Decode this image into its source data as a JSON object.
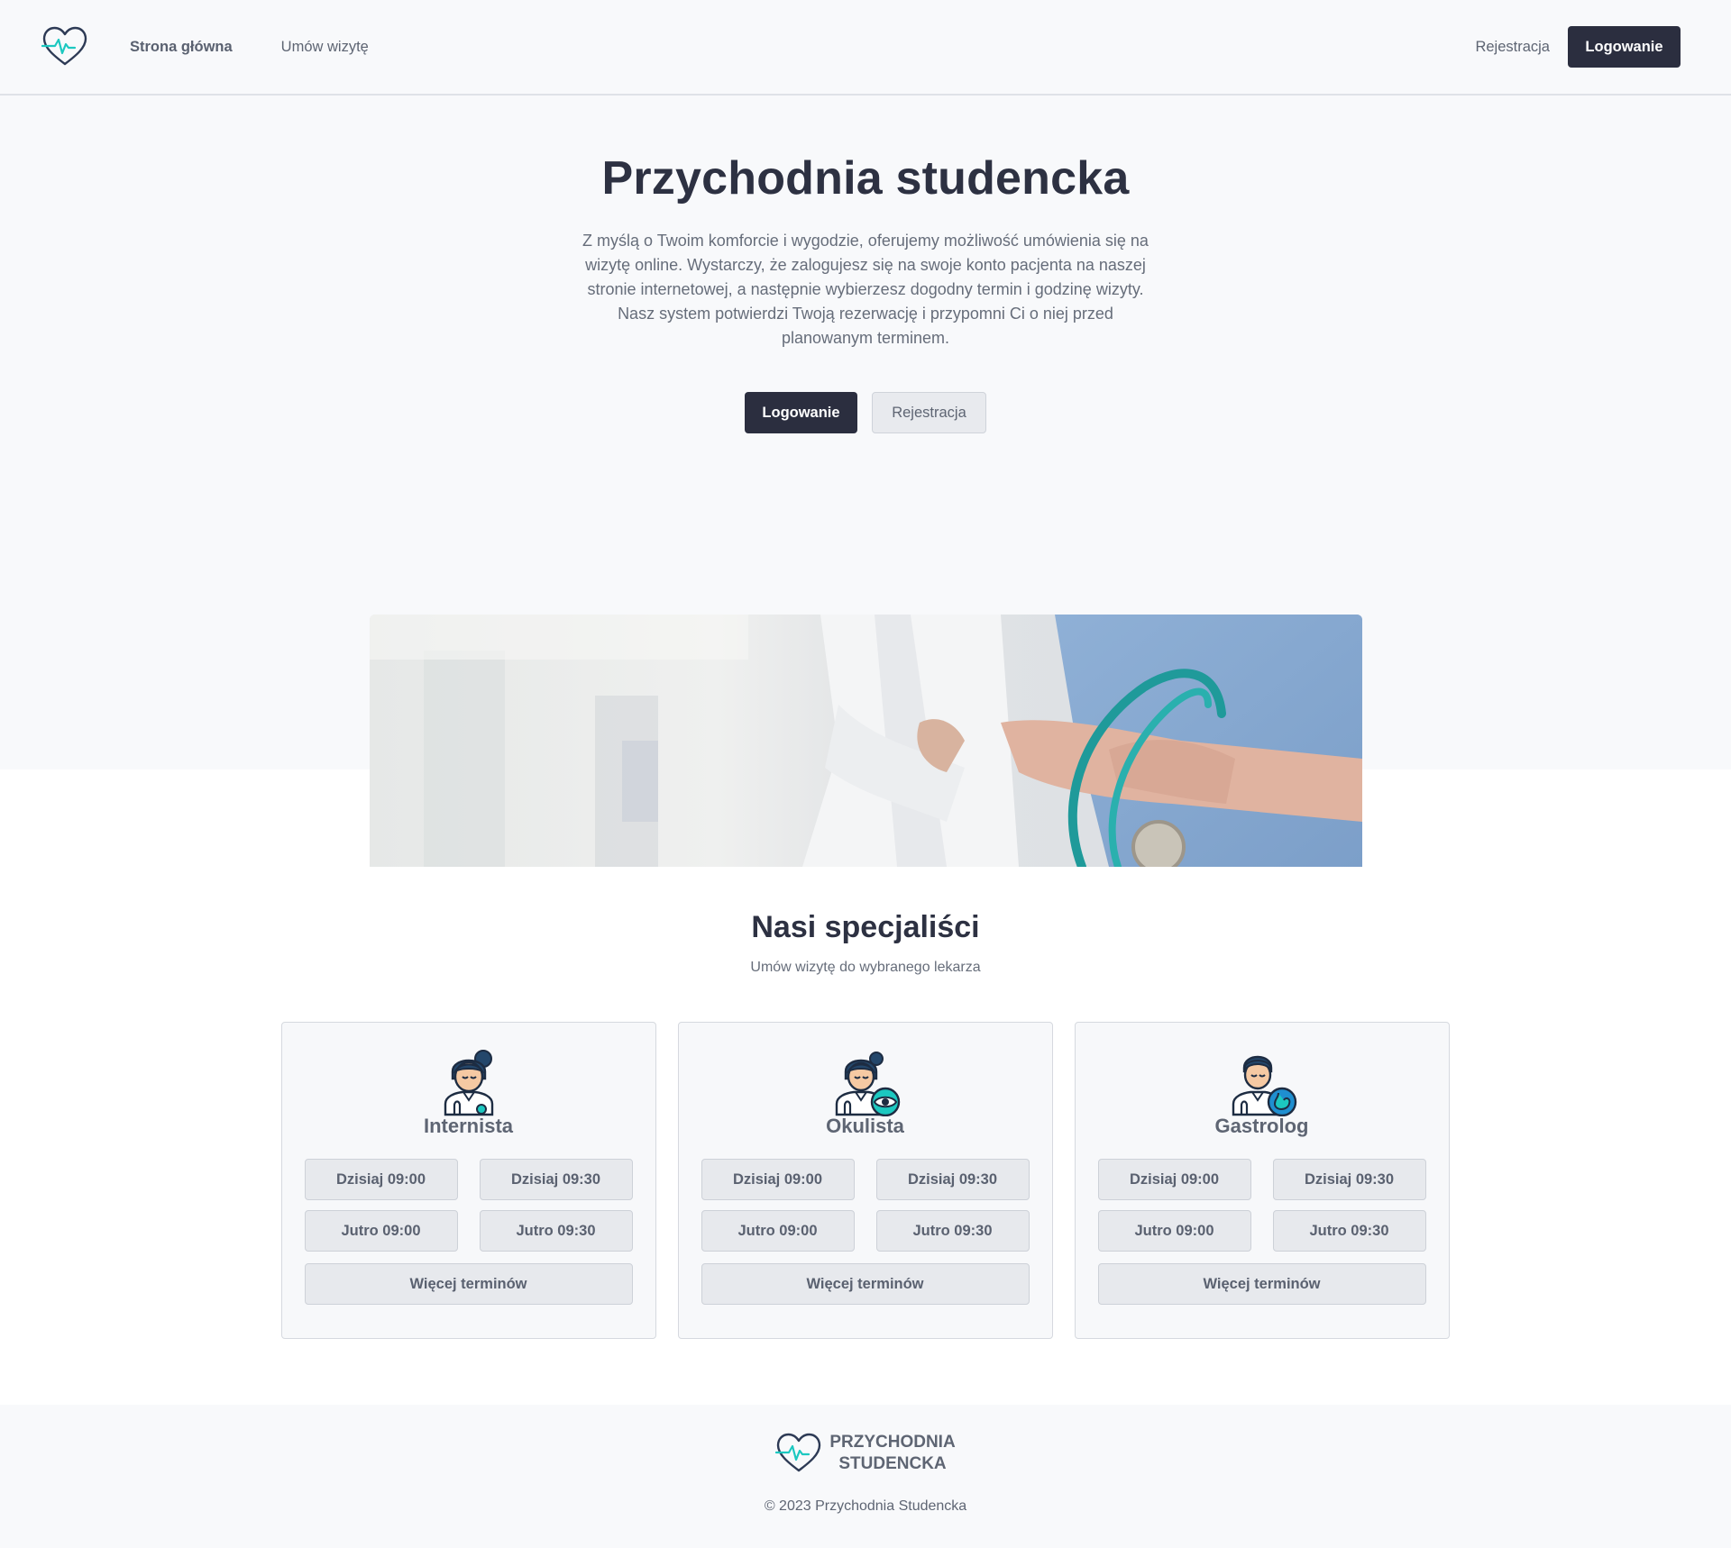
{
  "nav": {
    "home_label": "Strona główna",
    "book_label": "Umów wizytę",
    "register_label": "Rejestracja",
    "login_label": "Logowanie"
  },
  "hero": {
    "title": "Przychodnia studencka",
    "description": "Z myślą o Twoim komforcie i wygodzie, oferujemy możliwość umówienia się na wizytę online. Wystarczy, że zalogujesz się na swoje konto pacjenta na naszej stronie internetowej, a następnie wybierzesz dogodny termin i godzinę wizyty. Nasz system potwierdzi Twoją rezerwację i przypomni Ci o niej przed planowanym terminem.",
    "login_label": "Logowanie",
    "register_label": "Rejestracja"
  },
  "specialists": {
    "title": "Nasi specjaliści",
    "subtitle": "Umów wizytę do wybranego lekarza",
    "doctors": [
      {
        "name": "Internista",
        "icon": "female-doctor-icon",
        "slots": [
          "Dzisiaj 09:00",
          "Dzisiaj 09:30",
          "Jutro 09:00",
          "Jutro 09:30"
        ],
        "more_label": "Więcej terminów"
      },
      {
        "name": "Okulista",
        "icon": "eye-doctor-icon",
        "slots": [
          "Dzisiaj 09:00",
          "Dzisiaj 09:30",
          "Jutro 09:00",
          "Jutro 09:30"
        ],
        "more_label": "Więcej terminów"
      },
      {
        "name": "Gastrolog",
        "icon": "stomach-doctor-icon",
        "slots": [
          "Dzisiaj 09:00",
          "Dzisiaj 09:30",
          "Jutro 09:00",
          "Jutro 09:30"
        ],
        "more_label": "Więcej terminów"
      }
    ]
  },
  "footer": {
    "brand_line1": "PRZYCHODNIA",
    "brand_line2": "STUDENCKA",
    "copyright": "© 2023 Przychodnia Studencka"
  },
  "colors": {
    "primary_dark": "#2b2e3f",
    "accent_teal": "#1cc8c0",
    "page_bg": "#f8f9fb"
  }
}
